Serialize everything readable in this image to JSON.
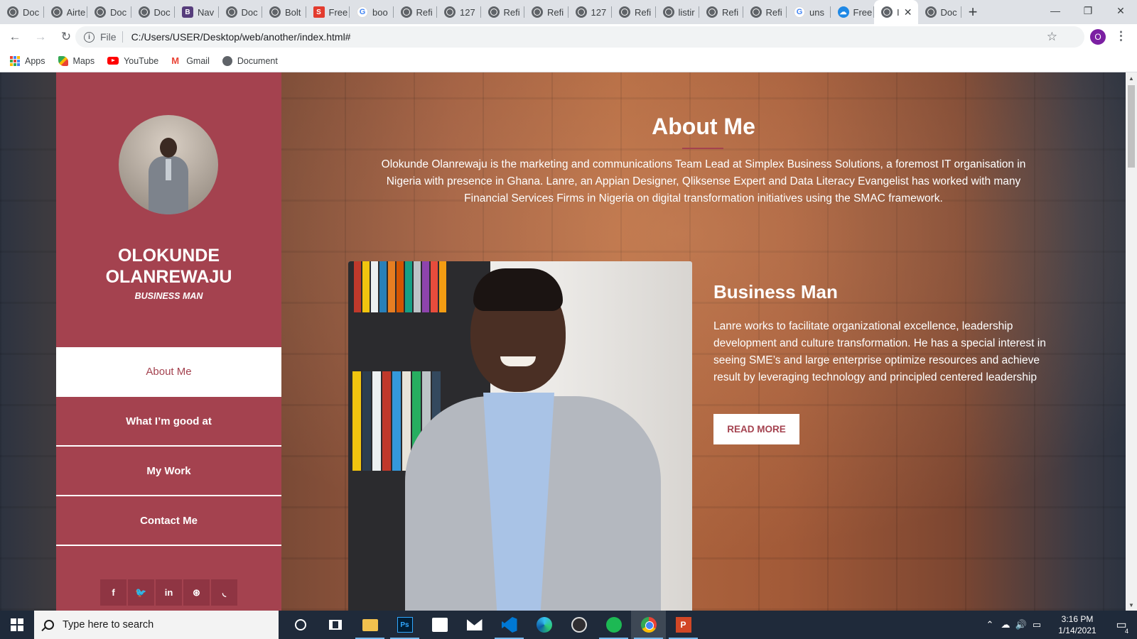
{
  "browser": {
    "tabs": [
      {
        "label": "Doc",
        "icon": "globe-icon"
      },
      {
        "label": "Airte",
        "icon": "globe-icon"
      },
      {
        "label": "Doc",
        "icon": "globe-icon"
      },
      {
        "label": "Doc",
        "icon": "globe-icon"
      },
      {
        "label": "Nav",
        "icon": "bootstrap-icon"
      },
      {
        "label": "Doc",
        "icon": "globe-icon"
      },
      {
        "label": "Bolt",
        "icon": "globe-icon"
      },
      {
        "label": "Free",
        "icon": "s-icon"
      },
      {
        "label": "boo",
        "icon": "google-icon"
      },
      {
        "label": "Refi",
        "icon": "globe-icon"
      },
      {
        "label": "127",
        "icon": "globe-icon"
      },
      {
        "label": "Refi",
        "icon": "globe-icon"
      },
      {
        "label": "Refi",
        "icon": "globe-icon"
      },
      {
        "label": "127",
        "icon": "globe-icon"
      },
      {
        "label": "Refi",
        "icon": "globe-icon"
      },
      {
        "label": "listir",
        "icon": "globe-icon"
      },
      {
        "label": "Refi",
        "icon": "globe-icon"
      },
      {
        "label": "Refi",
        "icon": "globe-icon"
      },
      {
        "label": "uns",
        "icon": "google-icon"
      },
      {
        "label": "Free",
        "icon": "cloudsave-icon"
      },
      {
        "label": "I",
        "icon": "globe-icon",
        "active": true
      },
      {
        "label": "Doc",
        "icon": "globe-icon"
      }
    ],
    "new_tab": "+",
    "window_controls": {
      "minimize": "—",
      "restore": "❐",
      "close": "✕"
    },
    "nav": {
      "back": "←",
      "forward": "→",
      "reload": "↻"
    },
    "omnibox": {
      "info": "i",
      "scheme": "File",
      "url": "C:/Users/USER/Desktop/web/another/index.html#",
      "star": "☆"
    },
    "profile_initial": "O",
    "menu": "⋮",
    "bookmarks": [
      {
        "label": "Apps",
        "icon": "apps-icon"
      },
      {
        "label": "Maps",
        "icon": "maps-icon"
      },
      {
        "label": "YouTube",
        "icon": "youtube-icon"
      },
      {
        "label": "Gmail",
        "icon": "gmail-icon"
      },
      {
        "label": "Document",
        "icon": "globe-icon"
      }
    ]
  },
  "page": {
    "colors": {
      "accent": "#a4424f",
      "accent_dark": "#8f3543",
      "text": "#ffffff"
    },
    "sidebar": {
      "name": "OLOKUNDE OLANREWAJU",
      "role": "BUSINESS MAN",
      "menu": [
        {
          "label": "About Me",
          "active": true
        },
        {
          "label": "What I’m good at"
        },
        {
          "label": "My Work"
        },
        {
          "label": "Contact Me"
        }
      ],
      "social": [
        {
          "glyph": "f",
          "icon": "facebook-icon"
        },
        {
          "glyph": "🐦",
          "icon": "twitter-icon"
        },
        {
          "glyph": "in",
          "icon": "linkedin-icon"
        },
        {
          "glyph": "⊛",
          "icon": "dribbble-icon"
        },
        {
          "glyph": "◟",
          "icon": "rss-icon"
        }
      ]
    },
    "about": {
      "title": "About Me",
      "intro": "Olokunde Olanrewaju is the marketing and communications Team Lead at Simplex Business Solutions, a foremost IT organisation in Nigeria with presence in Ghana. Lanre, an Appian Designer, Qliksense Expert and Data Literacy Evangelist has worked with many Financial Services Firms in Nigeria on digital transformation initiatives using the SMAC framework.",
      "card_title": "Business Man",
      "card_text": "Lanre works to facilitate organizational excellence, leadership development and culture transformation. He has a special interest in seeing SME’s and large enterprise optimize resources and achieve result by leveraging technology and principled centered leadership",
      "button": "READ MORE"
    }
  },
  "taskbar": {
    "search_placeholder": "Type here to search",
    "ppt_letter": "P",
    "ps_letters": "Ps",
    "time": "3:16 PM",
    "date": "1/14/2021",
    "notifications": "4"
  }
}
